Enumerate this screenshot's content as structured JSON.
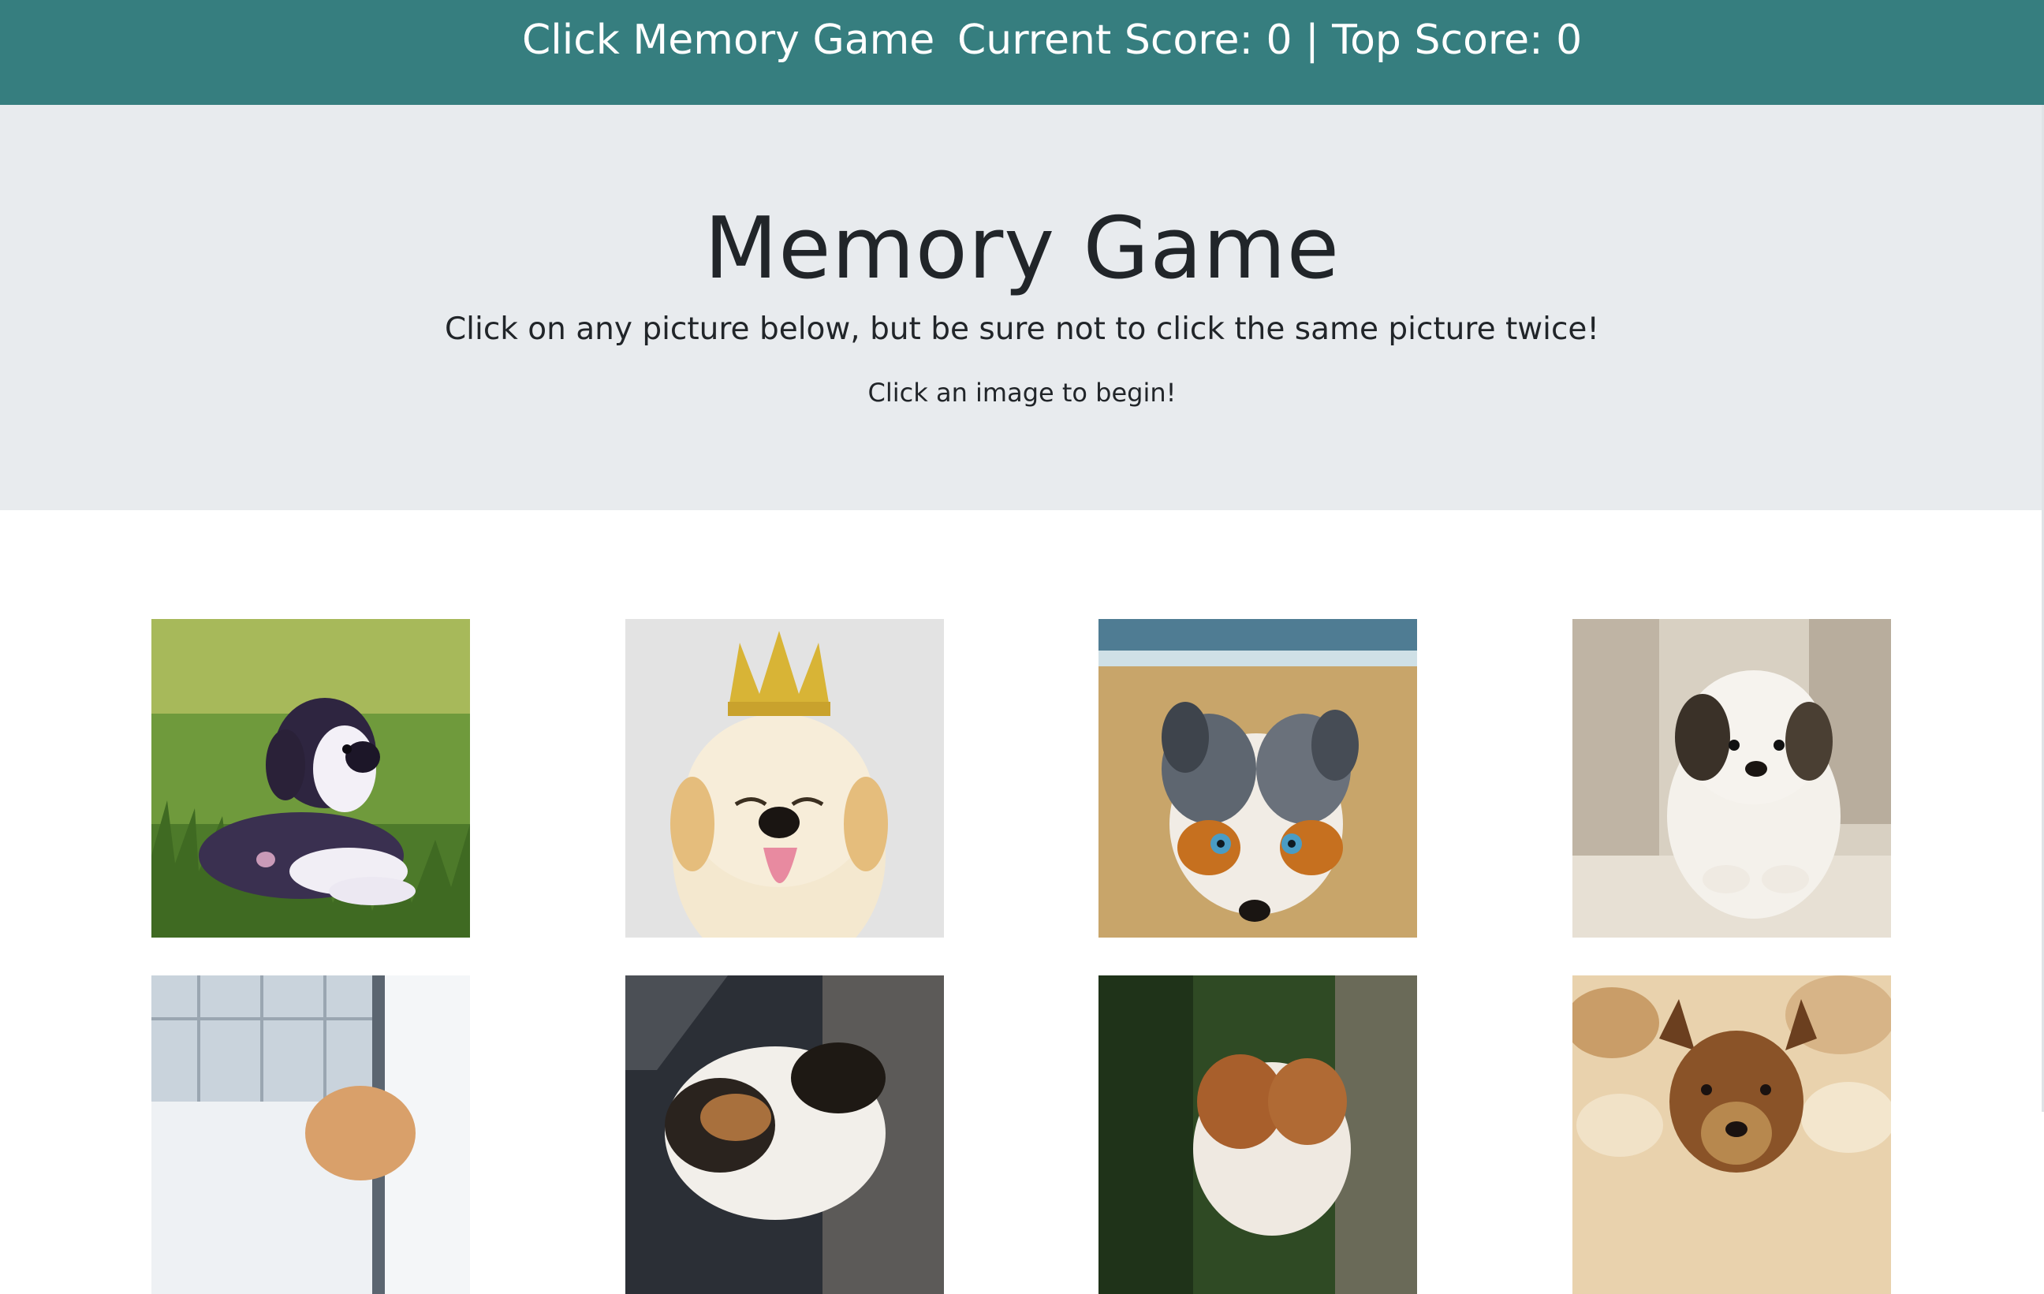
{
  "navbar": {
    "brand": "Click Memory Game",
    "score_text": "Current Score: 0 | Top Score: 0",
    "background_color": "#367e7f"
  },
  "hero": {
    "title": "Memory Game",
    "subtitle": "Click on any picture below, but be sure not to click the same picture twice!",
    "status": "Click an image to begin!",
    "background_color": "#e8ebee"
  },
  "cards": [
    {
      "name": "puppy-image-1",
      "subject": "black and white puppy lying in grass"
    },
    {
      "name": "puppy-image-2",
      "subject": "golden puppy wearing a gold crown"
    },
    {
      "name": "puppy-image-3",
      "subject": "merle puppy lying in beach sand"
    },
    {
      "name": "puppy-image-4",
      "subject": "fluffy white puppy on a blanket"
    },
    {
      "name": "puppy-image-5",
      "subject": "puppy by a window"
    },
    {
      "name": "puppy-image-6",
      "subject": "tricolor puppy"
    },
    {
      "name": "puppy-image-7",
      "subject": "brown and white puppy on green background"
    },
    {
      "name": "puppy-image-8",
      "subject": "brown puppy among rocks"
    }
  ]
}
